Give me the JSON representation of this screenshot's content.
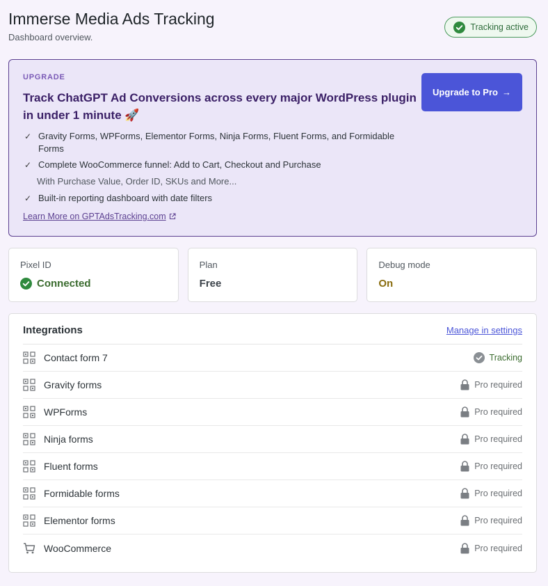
{
  "header": {
    "title": "Immerse Media Ads Tracking",
    "subtitle": "Dashboard overview.",
    "status": "Tracking active",
    "status_icon": "check-circle-icon"
  },
  "upgrade": {
    "eyebrow": "UPGRADE",
    "headline": "Track ChatGPT Ad Conversions across every major WordPress plugin in under 1 minute 🚀",
    "features": [
      "Gravity Forms, WPForms, Elementor Forms, Ninja Forms, Fluent Forms, and Formidable Forms",
      "Complete WooCommerce funnel: Add to Cart, Checkout and Purchase",
      "With Purchase Value, Order ID, SKUs and More...",
      "Built-in reporting dashboard with date filters"
    ],
    "learn_more": "Learn More on GPTAdsTracking.com",
    "button": "Upgrade to Pro",
    "button_arrow": "→",
    "accent": "#4b55d8"
  },
  "stats": [
    {
      "label": "Pixel ID",
      "value": "Connected",
      "icon": "check-circle-icon",
      "color": "#3a6b2e"
    },
    {
      "label": "Plan",
      "value": "Free",
      "color": "#3c434a"
    },
    {
      "label": "Debug mode",
      "value": "On",
      "color": "#8a6d0f"
    }
  ],
  "integrations": {
    "title": "Integrations",
    "manage_link": "Manage in settings",
    "rows": [
      {
        "name": "Contact form 7",
        "status": "Tracking",
        "icon": "form-grid-icon",
        "status_icon": "check-circle-icon"
      },
      {
        "name": "Gravity forms",
        "status": "Pro required",
        "icon": "form-grid-icon",
        "status_icon": "lock-icon"
      },
      {
        "name": "WPForms",
        "status": "Pro required",
        "icon": "form-grid-icon",
        "status_icon": "lock-icon"
      },
      {
        "name": "Ninja forms",
        "status": "Pro required",
        "icon": "form-grid-icon",
        "status_icon": "lock-icon"
      },
      {
        "name": "Fluent forms",
        "status": "Pro required",
        "icon": "form-grid-icon",
        "status_icon": "lock-icon"
      },
      {
        "name": "Formidable forms",
        "status": "Pro required",
        "icon": "form-grid-icon",
        "status_icon": "lock-icon"
      },
      {
        "name": "Elementor forms",
        "status": "Pro required",
        "icon": "form-grid-icon",
        "status_icon": "lock-icon"
      },
      {
        "name": "WooCommerce",
        "status": "Pro required",
        "icon": "cart-icon",
        "status_icon": "lock-icon"
      }
    ]
  }
}
